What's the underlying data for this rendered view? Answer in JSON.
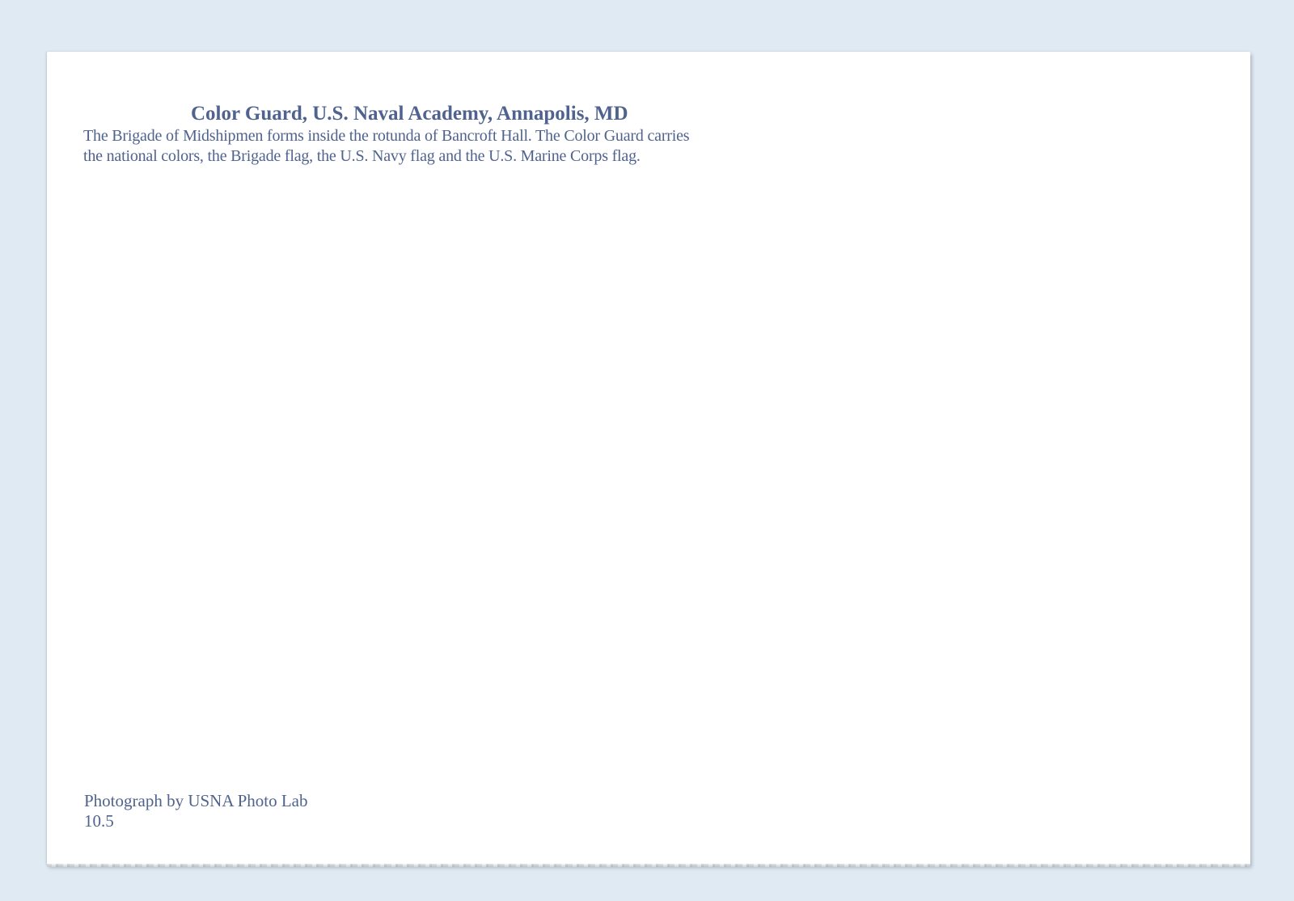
{
  "caption": {
    "title": "Color Guard, U.S. Naval Academy, Annapolis, MD",
    "line1": "The Brigade of Midshipmen forms inside the rotunda of Bancroft Hall.  The Color Guard carries",
    "line2": "the national colors, the Brigade flag, the U.S. Navy flag and the U.S. Marine Corps flag."
  },
  "credit": {
    "photographer": "Photograph by USNA Photo Lab",
    "code": "10.5"
  },
  "colors": {
    "ink": "#50638e",
    "card": "#ffffff",
    "background": "#dfeaf3"
  }
}
